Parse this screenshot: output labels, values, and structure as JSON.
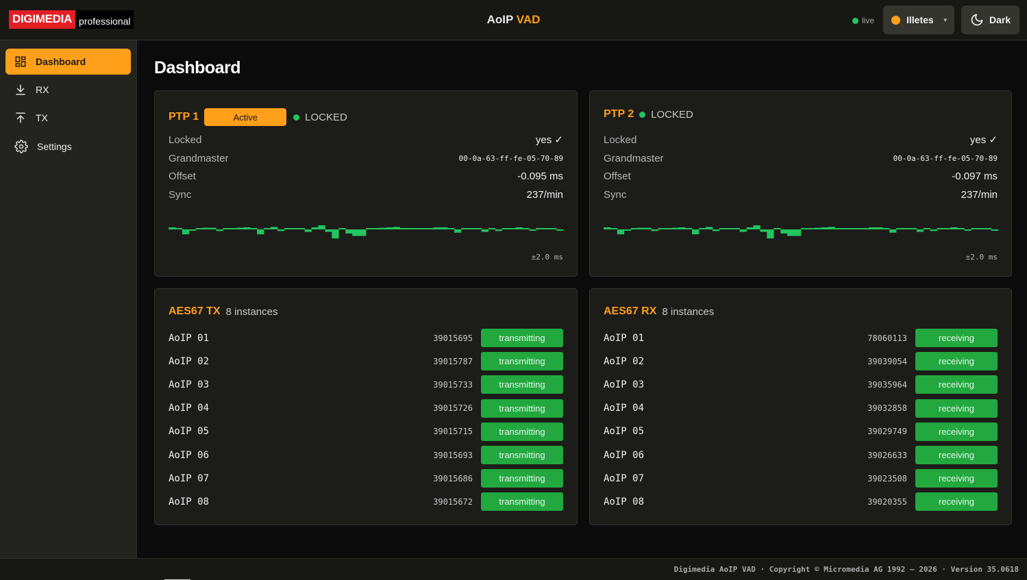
{
  "header": {
    "logo_main": "DIGIMEDIA",
    "logo_sub": "professional",
    "title_part1": "AoIP",
    "title_part2": "VAD",
    "live_label": "live",
    "user_label": "Illetes",
    "theme_label": "Dark"
  },
  "sidebar": {
    "items": [
      {
        "label": "Dashboard",
        "icon": "dashboard-grid-icon",
        "active": true
      },
      {
        "label": "RX",
        "icon": "download-icon",
        "active": false
      },
      {
        "label": "TX",
        "icon": "upload-icon",
        "active": false
      },
      {
        "label": "Settings",
        "icon": "gear-icon",
        "active": false
      }
    ]
  },
  "page": {
    "title": "Dashboard"
  },
  "ptp1": {
    "title": "PTP 1",
    "badge": "Active",
    "status": "LOCKED",
    "rows": [
      {
        "key": "Locked",
        "value": "yes ✓"
      },
      {
        "key": "Grandmaster",
        "value": "00-0a-63-ff-fe-05-70-89"
      },
      {
        "key": "Offset",
        "value": "-0.095 ms"
      },
      {
        "key": "Sync",
        "value": "237/min"
      }
    ],
    "range": "±2.0 ms",
    "offset_history": [
      0.05,
      0.03,
      -0.12,
      -0.02,
      0.03,
      0.04,
      0.04,
      -0.04,
      0.02,
      0.03,
      0.04,
      0.05,
      0.02,
      -0.12,
      0.02,
      0.06,
      -0.04,
      0.02,
      0,
      0.02,
      -0.06,
      0.05,
      0.1,
      -0.06,
      -0.22,
      0.03,
      -0.1,
      -0.16,
      -0.16,
      0.02,
      0.03,
      0.04,
      0.05,
      0.06,
      0.02,
      0.03,
      0.02,
      0,
      0.02,
      0.05,
      0.05,
      0.02,
      -0.08,
      0.02,
      0,
      0.03,
      -0.06,
      0,
      -0.04,
      0.02,
      0.02,
      0.05,
      0.02,
      -0.03,
      0.03,
      0,
      0.02,
      -0.03
    ]
  },
  "ptp2": {
    "title": "PTP 2",
    "status": "LOCKED",
    "rows": [
      {
        "key": "Locked",
        "value": "yes ✓"
      },
      {
        "key": "Grandmaster",
        "value": "00-0a-63-ff-fe-05-70-89"
      },
      {
        "key": "Offset",
        "value": "-0.097 ms"
      },
      {
        "key": "Sync",
        "value": "237/min"
      }
    ],
    "range": "±2.0 ms",
    "offset_history": [
      0.05,
      0.03,
      -0.12,
      -0.02,
      0.03,
      0.04,
      0.04,
      -0.04,
      0.02,
      0.03,
      0.04,
      0.05,
      0.02,
      -0.12,
      0.02,
      0.06,
      -0.04,
      0.02,
      0,
      0.02,
      -0.06,
      0.05,
      0.1,
      -0.06,
      -0.22,
      0.03,
      -0.1,
      -0.16,
      -0.16,
      0.02,
      0.03,
      0.04,
      0.05,
      0.06,
      0.02,
      0.03,
      0.02,
      0,
      0.02,
      0.05,
      0.05,
      0.02,
      -0.08,
      0.02,
      0,
      0.03,
      -0.06,
      0,
      -0.04,
      0.02,
      0.02,
      0.05,
      0.02,
      -0.03,
      0.03,
      0,
      0.02,
      -0.03
    ]
  },
  "tx": {
    "title": "AES67 TX",
    "count": "8 instances",
    "instances": [
      {
        "name": "AoIP 01",
        "id": "39015695",
        "status": "transmitting"
      },
      {
        "name": "AoIP 02",
        "id": "39015787",
        "status": "transmitting"
      },
      {
        "name": "AoIP 03",
        "id": "39015733",
        "status": "transmitting"
      },
      {
        "name": "AoIP 04",
        "id": "39015726",
        "status": "transmitting"
      },
      {
        "name": "AoIP 05",
        "id": "39015715",
        "status": "transmitting"
      },
      {
        "name": "AoIP 06",
        "id": "39015693",
        "status": "transmitting"
      },
      {
        "name": "AoIP 07",
        "id": "39015686",
        "status": "transmitting"
      },
      {
        "name": "AoIP 08",
        "id": "39015672",
        "status": "transmitting"
      }
    ]
  },
  "rx": {
    "title": "AES67 RX",
    "count": "8 instances",
    "instances": [
      {
        "name": "AoIP 01",
        "id": "78060113",
        "status": "receiving"
      },
      {
        "name": "AoIP 02",
        "id": "39039054",
        "status": "receiving"
      },
      {
        "name": "AoIP 03",
        "id": "39035964",
        "status": "receiving"
      },
      {
        "name": "AoIP 04",
        "id": "39032858",
        "status": "receiving"
      },
      {
        "name": "AoIP 05",
        "id": "39029749",
        "status": "receiving"
      },
      {
        "name": "AoIP 06",
        "id": "39026633",
        "status": "receiving"
      },
      {
        "name": "AoIP 07",
        "id": "39023508",
        "status": "receiving"
      },
      {
        "name": "AoIP 08",
        "id": "39020355",
        "status": "receiving"
      }
    ]
  },
  "footer": {
    "text": "Digimedia AoIP VAD · Copyright © Micromedia AG 1992 – 2026 · Version 35.0618"
  },
  "colors": {
    "accent": "#ff9f1a",
    "ok": "#22c55e",
    "status_bg": "#22a83f",
    "brand_red": "#e31e24"
  }
}
